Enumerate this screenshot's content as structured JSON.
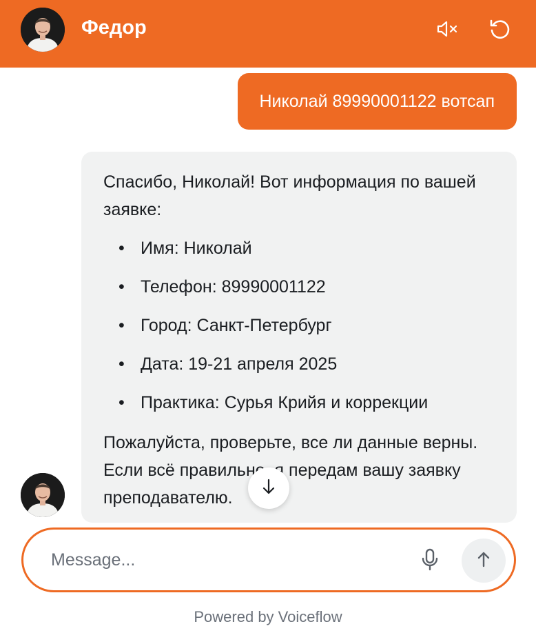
{
  "header": {
    "title": "Федор",
    "mute_icon": "speaker-muted-icon",
    "reset_icon": "reset-icon"
  },
  "messages": {
    "user_text": "Николай 89990001122 вотсап",
    "bot": {
      "intro": "Спасибо, Николай! Вот информация по вашей заявке:",
      "items": [
        "Имя: Николай",
        "Телефон: 89990001122",
        "Город: Санкт-Петербург",
        "Дата: 19-21 апреля 2025",
        "Практика: Сурья Крийя и коррекции"
      ],
      "outro": "Пожалуйста, проверьте, все ли данные верны. Если всё правильно, я передам вашу заявку преподавателю."
    }
  },
  "composer": {
    "placeholder": "Message...",
    "mic_icon": "microphone-icon",
    "send_icon": "arrow-up-icon"
  },
  "footer": {
    "powered_by": "Powered by Voiceflow"
  },
  "colors": {
    "accent": "#ee6a23",
    "bot_bubble": "#f1f2f2"
  }
}
